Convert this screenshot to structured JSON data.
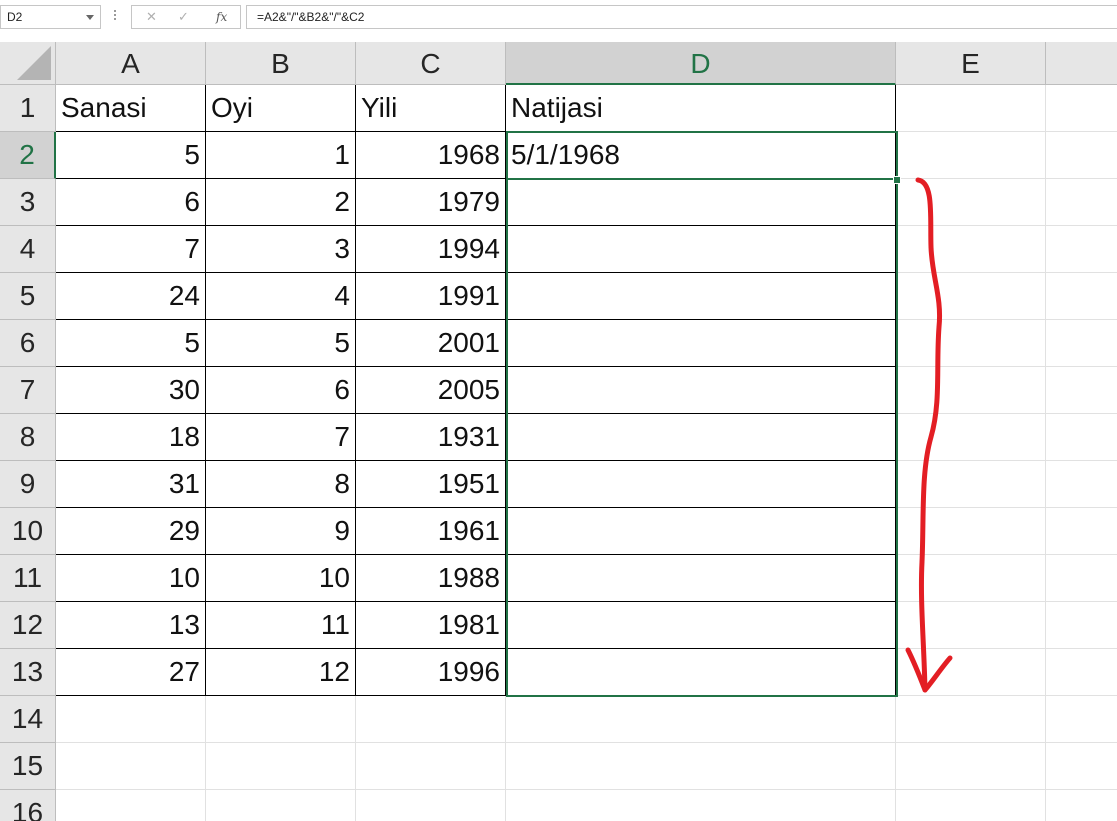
{
  "name_box": {
    "value": "D2"
  },
  "formula_bar": {
    "cancel_glyph": "✕",
    "enter_glyph": "✓",
    "fx_label": "fx",
    "formula": "=A2&\"/\"&B2&\"/\"&C2"
  },
  "columns": [
    "A",
    "B",
    "C",
    "D",
    "E"
  ],
  "active_column": "D",
  "active_row": "2",
  "row_numbers": [
    "1",
    "2",
    "3",
    "4",
    "5",
    "6",
    "7",
    "8",
    "9",
    "10",
    "11",
    "12",
    "13",
    "14",
    "15",
    "16"
  ],
  "headers": {
    "a": "Sanasi",
    "b": "Oyi",
    "c": "Yili",
    "d": "Natijasi"
  },
  "rows": [
    {
      "a": "5",
      "b": "1",
      "c": "1968",
      "d": "5/1/1968"
    },
    {
      "a": "6",
      "b": "2",
      "c": "1979",
      "d": ""
    },
    {
      "a": "7",
      "b": "3",
      "c": "1994",
      "d": ""
    },
    {
      "a": "24",
      "b": "4",
      "c": "1991",
      "d": ""
    },
    {
      "a": "5",
      "b": "5",
      "c": "2001",
      "d": ""
    },
    {
      "a": "30",
      "b": "6",
      "c": "2005",
      "d": ""
    },
    {
      "a": "18",
      "b": "7",
      "c": "1931",
      "d": ""
    },
    {
      "a": "31",
      "b": "8",
      "c": "1951",
      "d": ""
    },
    {
      "a": "29",
      "b": "9",
      "c": "1961",
      "d": ""
    },
    {
      "a": "10",
      "b": "10",
      "c": "1988",
      "d": ""
    },
    {
      "a": "13",
      "b": "11",
      "c": "1981",
      "d": ""
    },
    {
      "a": "27",
      "b": "12",
      "c": "1996",
      "d": ""
    }
  ],
  "colors": {
    "selection": "#217346",
    "annotation_arrow": "#e31e24",
    "header_bg": "#e6e6e6",
    "active_header_bg": "#d2d2d2"
  }
}
